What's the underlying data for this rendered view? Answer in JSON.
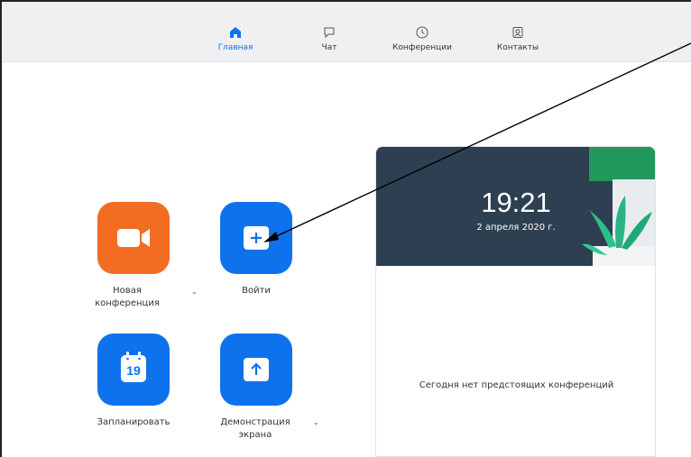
{
  "nav": {
    "items": [
      {
        "label": "Главная",
        "icon": "home-icon",
        "active": true
      },
      {
        "label": "Чат",
        "icon": "chat-icon",
        "active": false
      },
      {
        "label": "Конференции",
        "icon": "clock-icon",
        "active": false
      },
      {
        "label": "Контакты",
        "icon": "contacts-icon",
        "active": false
      }
    ]
  },
  "actions": {
    "new_meeting": {
      "label": "Новая\nконференция",
      "icon": "video-camera-icon",
      "color": "#f26d21"
    },
    "join": {
      "label": "Войти",
      "icon": "plus-icon",
      "color": "#0e72ed"
    },
    "schedule": {
      "label": "Запланировать",
      "icon": "calendar-icon",
      "calendar_day": "19",
      "color": "#0e72ed"
    },
    "share_screen": {
      "label": "Демонстрация\nэкрана",
      "icon": "upload-arrow-icon",
      "color": "#0e72ed"
    }
  },
  "card": {
    "time": "19:21",
    "date": "2 апреля 2020 г.",
    "empty_message": "Сегодня нет предстоящих конференций"
  },
  "colors": {
    "accent": "#0e72ed",
    "orange": "#f26d21",
    "header_bg": "#2e3f52"
  }
}
